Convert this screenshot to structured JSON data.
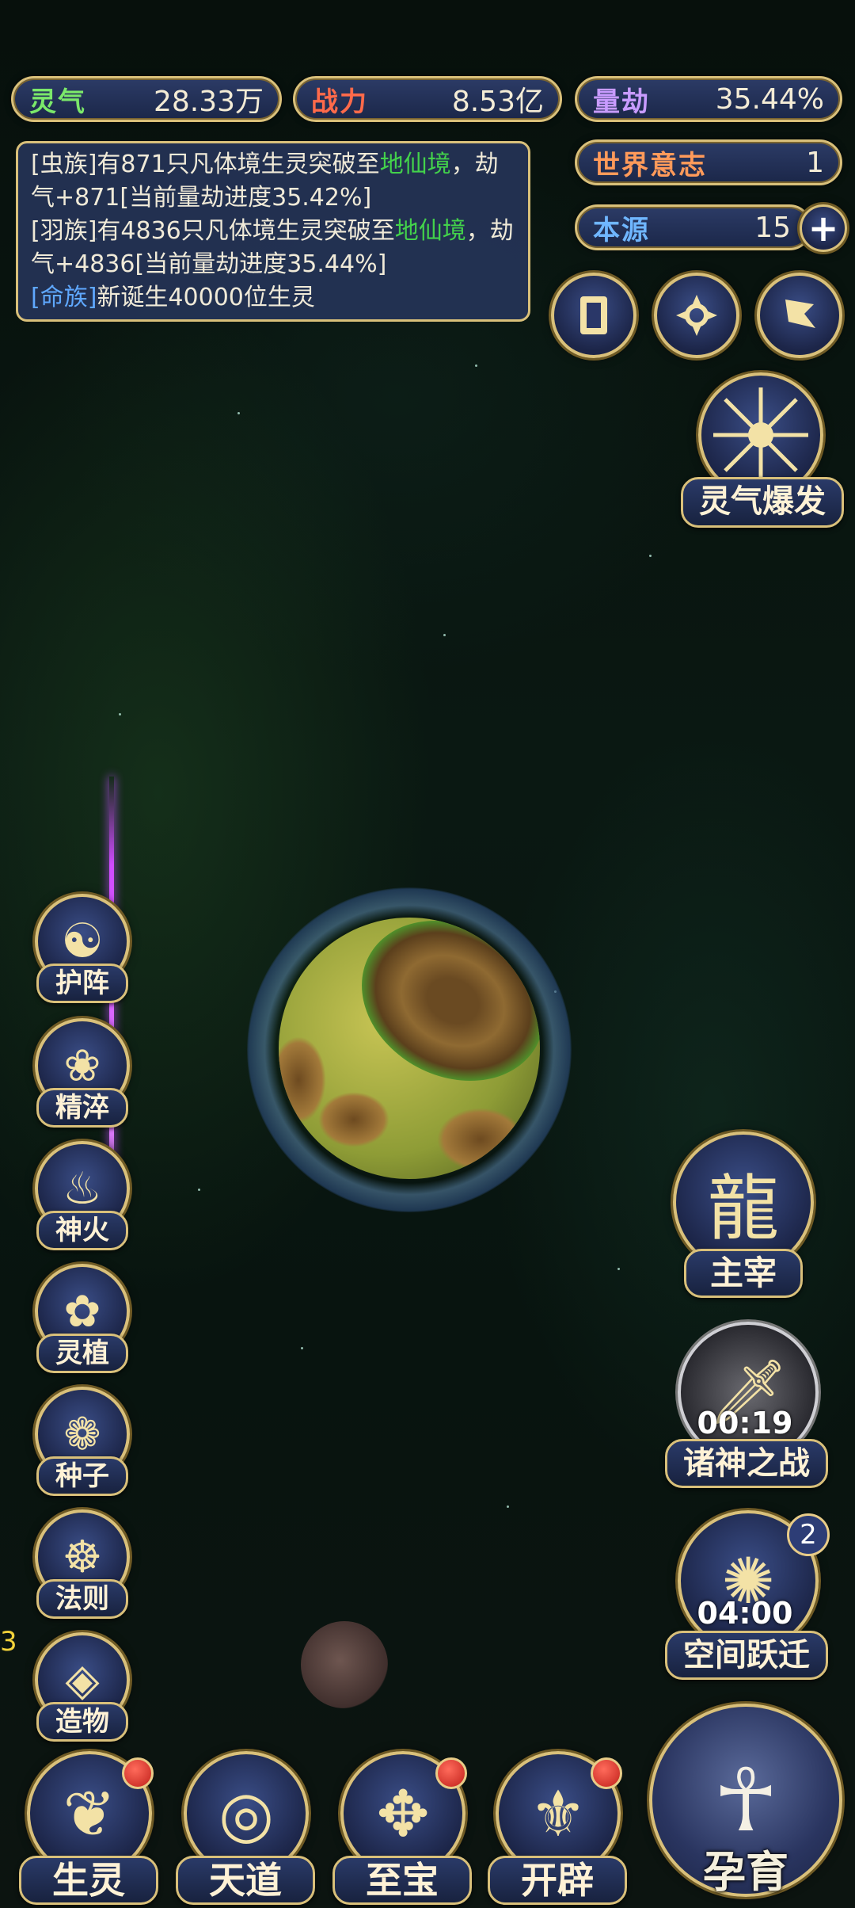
{
  "stats": {
    "lingqi": {
      "label": "灵气",
      "value": "28.33万"
    },
    "zhanli": {
      "label": "战力",
      "value": "8.53亿"
    },
    "liangjie": {
      "label": "量劫",
      "value": "35.44%"
    },
    "world_will": {
      "label": "世界意志",
      "value": "1"
    },
    "benyuan": {
      "label": "本源",
      "value": "15"
    }
  },
  "log": {
    "line1": {
      "race": "[虫族]",
      "text": "有871只凡体境生灵突破至",
      "realm": "地仙境",
      "tail": "，劫气+871[当前量劫进度35.42%]"
    },
    "line2": {
      "race": "[羽族]",
      "text": "有4836只凡体境生灵突破至",
      "realm": "地仙境",
      "tail": "，劫气+4836[当前量劫进度35.44%]"
    },
    "line3": {
      "race_prefix": "[",
      "race": "命族",
      "race_suffix": "]",
      "text": "新诞生40000位生灵"
    }
  },
  "right_top": {
    "burst_label": "灵气爆发"
  },
  "left_menu": [
    {
      "label": "护阵",
      "icon": "yin-yang-icon"
    },
    {
      "label": "精淬",
      "icon": "lotus-flame-icon"
    },
    {
      "label": "神火",
      "icon": "fire-icon"
    },
    {
      "label": "灵植",
      "icon": "plant-icon"
    },
    {
      "label": "种子",
      "icon": "flower-icon"
    },
    {
      "label": "法则",
      "icon": "rune-icon"
    },
    {
      "label": "造物",
      "icon": "diamond-rune-icon"
    }
  ],
  "right_menu": {
    "master": {
      "label": "主宰"
    },
    "gods_war": {
      "label": "诸神之战",
      "timer": "00:19"
    },
    "space_jump": {
      "label": "空间跃迁",
      "timer": "04:00",
      "badge": "2"
    }
  },
  "edge_text": "3",
  "bottom_nav": [
    {
      "label": "生灵",
      "has_dot": true
    },
    {
      "label": "天道",
      "has_dot": false
    },
    {
      "label": "至宝",
      "has_dot": true
    },
    {
      "label": "开辟",
      "has_dot": true
    }
  ],
  "incubate": {
    "label": "孕育"
  }
}
